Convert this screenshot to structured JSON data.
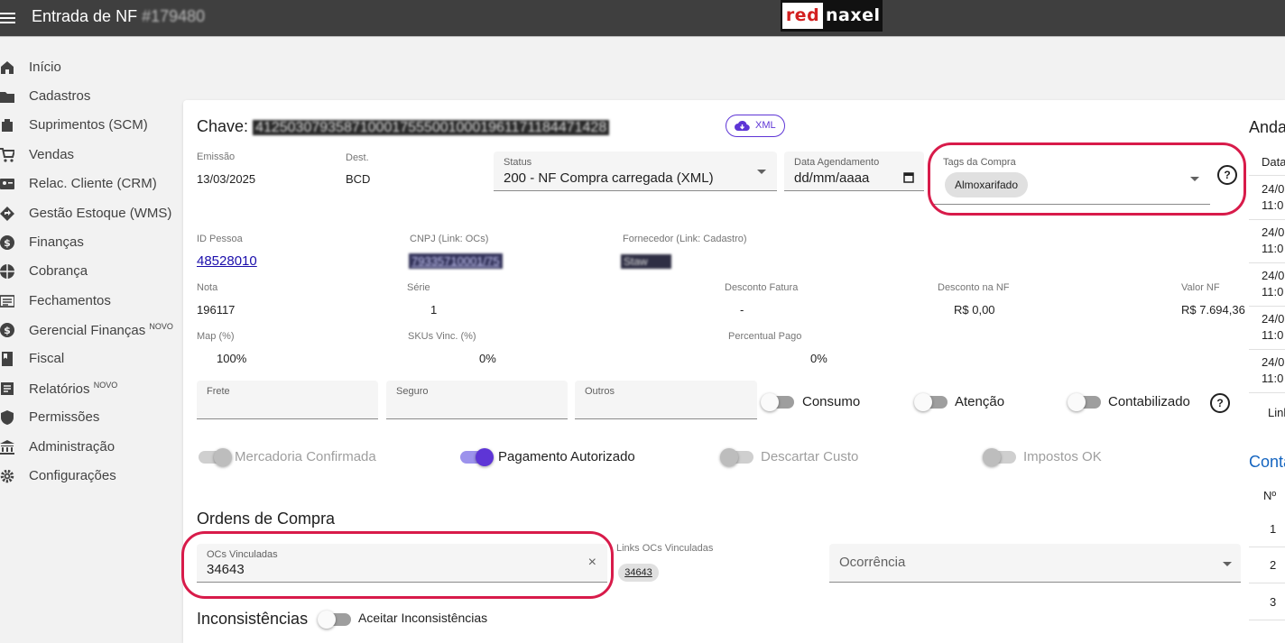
{
  "header": {
    "menu_icon": "menu-icon",
    "title": "Entrada de NF",
    "title_id": "#179480",
    "logo": {
      "left": "red",
      "right": "naxel"
    }
  },
  "sidebar": {
    "items": [
      {
        "label": "Início",
        "icon": "home-icon",
        "badge": ""
      },
      {
        "label": "Cadastros",
        "icon": "folder-icon",
        "badge": ""
      },
      {
        "label": "Suprimentos (SCM)",
        "icon": "inventory-icon",
        "badge": ""
      },
      {
        "label": "Vendas",
        "icon": "cart-icon",
        "badge": ""
      },
      {
        "label": "Relac. Cliente (CRM)",
        "icon": "contact-card-icon",
        "badge": ""
      },
      {
        "label": "Gestão Estoque (WMS)",
        "icon": "directions-icon",
        "badge": ""
      },
      {
        "label": "Finanças",
        "icon": "dollar-icon",
        "badge": ""
      },
      {
        "label": "Cobrança",
        "icon": "pie-chart-icon",
        "badge": ""
      },
      {
        "label": "Fechamentos",
        "icon": "list-icon",
        "badge": ""
      },
      {
        "label": "Gerencial Finanças",
        "icon": "dollar-icon",
        "badge": "NOVO"
      },
      {
        "label": "Fiscal",
        "icon": "book-icon",
        "badge": ""
      },
      {
        "label": "Relatórios",
        "icon": "report-icon",
        "badge": "NOVO"
      },
      {
        "label": "Permissões",
        "icon": "shield-icon",
        "badge": ""
      },
      {
        "label": "Administração",
        "icon": "bank-icon",
        "badge": ""
      },
      {
        "label": "Configurações",
        "icon": "gear-icon",
        "badge": ""
      }
    ]
  },
  "nf": {
    "chave_label": "Chave:",
    "chave_value": "41250307935871000175550010001961171184471428",
    "xml_button": "XML",
    "emissao": {
      "label": "Emissão",
      "value": "13/03/2025"
    },
    "dest": {
      "label": "Dest.",
      "value": "BCD"
    },
    "status": {
      "label": "Status",
      "value": "200 - NF Compra carregada (XML)"
    },
    "data_agendamento": {
      "label": "Data Agendamento",
      "value": "dd/mm/aaaa"
    },
    "tags": {
      "label": "Tags da Compra",
      "chip": "Almoxarifado"
    },
    "id_pessoa": {
      "label": "ID Pessoa",
      "value": "48528010"
    },
    "cnpj": {
      "label": "CNPJ (Link: OCs)",
      "value": "79335710001/75"
    },
    "fornecedor": {
      "label": "Fornecedor (Link: Cadastro)",
      "value": "Staw"
    },
    "nota": {
      "label": "Nota",
      "value": "196117"
    },
    "serie": {
      "label": "Série",
      "value": "1"
    },
    "desconto_fatura": {
      "label": "Desconto Fatura",
      "value": "-"
    },
    "desconto_nf": {
      "label": "Desconto na NF",
      "value": "R$ 0,00"
    },
    "valor_nf": {
      "label": "Valor NF",
      "value": "R$ 7.694,36"
    },
    "map": {
      "label": "Map (%)",
      "value": "100%"
    },
    "skus_vinc": {
      "label": "SKUs Vinc. (%)",
      "value": "0%"
    },
    "percentual_pago": {
      "label": "Percentual Pago",
      "value": "0%"
    },
    "frete": {
      "label": "Frete",
      "value": ""
    },
    "seguro": {
      "label": "Seguro",
      "value": ""
    },
    "outros": {
      "label": "Outros",
      "value": ""
    }
  },
  "toggles": {
    "consumo": {
      "label": "Consumo",
      "checked": false
    },
    "atencao": {
      "label": "Atenção",
      "checked": false
    },
    "contabilizado": {
      "label": "Contabilizado",
      "checked": false
    },
    "mercadoria_confirmada": {
      "label": "Mercadoria Confirmada",
      "checked": true,
      "disabled": true
    },
    "pagamento_autorizado": {
      "label": "Pagamento Autorizado",
      "checked": true
    },
    "descartar_custo": {
      "label": "Descartar Custo",
      "checked": false,
      "disabled": true
    },
    "impostos_ok": {
      "label": "Impostos OK",
      "checked": false,
      "disabled": true
    }
  },
  "ordens": {
    "title": "Ordens de Compra",
    "ocs_label": "OCs Vinculadas",
    "ocs_value": "34643",
    "links_label": "Links OCs Vinculadas",
    "links": [
      "34643"
    ],
    "ocorrencia_placeholder": "Ocorrência"
  },
  "inconsistencias": {
    "title": "Inconsistências",
    "toggle_label": "Aceitar Inconsistências"
  },
  "right_panel": {
    "andamento_title": "Anda",
    "col_header": "Data",
    "rows": [
      {
        "line1": "24/0",
        "line2": "11:0"
      },
      {
        "line1": "24/0",
        "line2": "11:0"
      },
      {
        "line1": "24/0",
        "line2": "11:0"
      },
      {
        "line1": "24/0",
        "line2": "11:0"
      },
      {
        "line1": "24/0",
        "line2": "11:0"
      }
    ],
    "link_text": "Linl",
    "contas_title": "Conta",
    "contas_col": "Nº",
    "contas_rows": [
      "1",
      "2",
      "3"
    ]
  },
  "colors": {
    "topbar": "#3f3f3f",
    "accent": "#5e35d6",
    "highlight": "#d81b4a",
    "link": "#1a0dab"
  }
}
